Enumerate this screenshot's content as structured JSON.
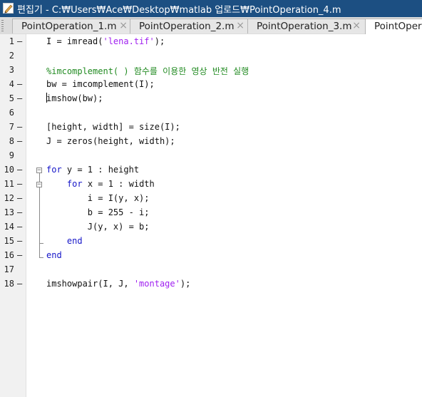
{
  "window": {
    "title": "편집기 - C:₩Users₩Ace₩Desktop₩matlab 업로드₩PointOperation_4.m"
  },
  "tabs": [
    {
      "label": "PointOperation_1.m",
      "close": "×"
    },
    {
      "label": "PointOperation_2.m",
      "close": "×"
    },
    {
      "label": "PointOperation_3.m",
      "close": "×"
    },
    {
      "label": "PointOpera",
      "close": ""
    }
  ],
  "editor": {
    "lines": [
      {
        "num": "1",
        "exec": "–",
        "code": "I = imread('lena.tif');"
      },
      {
        "num": "2",
        "exec": "",
        "code": ""
      },
      {
        "num": "3",
        "exec": "",
        "code": "%imcomplement( ) 함수를 이용한 영상 반전 실행"
      },
      {
        "num": "4",
        "exec": "–",
        "code": "bw = imcomplement(I);"
      },
      {
        "num": "5",
        "exec": "–",
        "code": "imshow(bw);"
      },
      {
        "num": "6",
        "exec": "",
        "code": ""
      },
      {
        "num": "7",
        "exec": "–",
        "code": "[height, width] = size(I);"
      },
      {
        "num": "8",
        "exec": "–",
        "code": "J = zeros(height, width);"
      },
      {
        "num": "9",
        "exec": "",
        "code": ""
      },
      {
        "num": "10",
        "exec": "–",
        "code": "for y = 1 : height"
      },
      {
        "num": "11",
        "exec": "–",
        "code": "    for x = 1 : width"
      },
      {
        "num": "12",
        "exec": "–",
        "code": "        i = I(y, x);"
      },
      {
        "num": "13",
        "exec": "–",
        "code": "        b = 255 - i;"
      },
      {
        "num": "14",
        "exec": "–",
        "code": "        J(y, x) = b;"
      },
      {
        "num": "15",
        "exec": "–",
        "code": "    end"
      },
      {
        "num": "16",
        "exec": "–",
        "code": "end"
      },
      {
        "num": "17",
        "exec": "",
        "code": ""
      },
      {
        "num": "18",
        "exec": "–",
        "code": "imshowpair(I, J, 'montage');"
      }
    ]
  },
  "colors": {
    "titlebar": "#1c4f82",
    "keyword": "#1515c8",
    "string": "#a020f0",
    "comment": "#228b22"
  }
}
